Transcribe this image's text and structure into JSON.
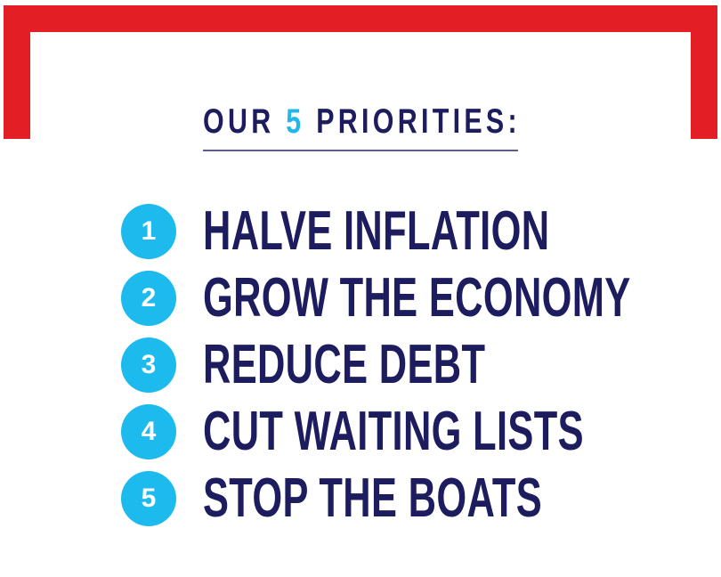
{
  "heading": {
    "prefix": "OUR",
    "number": "5",
    "suffix": "PRIORITIES:"
  },
  "priorities": [
    {
      "number": "1",
      "label": "HALVE INFLATION"
    },
    {
      "number": "2",
      "label": "GROW THE ECONOMY"
    },
    {
      "number": "3",
      "label": "REDUCE DEBT"
    },
    {
      "number": "4",
      "label": "CUT WAITING LISTS"
    },
    {
      "number": "5",
      "label": "STOP THE BOATS"
    }
  ],
  "colors": {
    "frame": "#e31e24",
    "text": "#1c1c5e",
    "accent": "#1cbaed",
    "background": "#ffffff"
  }
}
